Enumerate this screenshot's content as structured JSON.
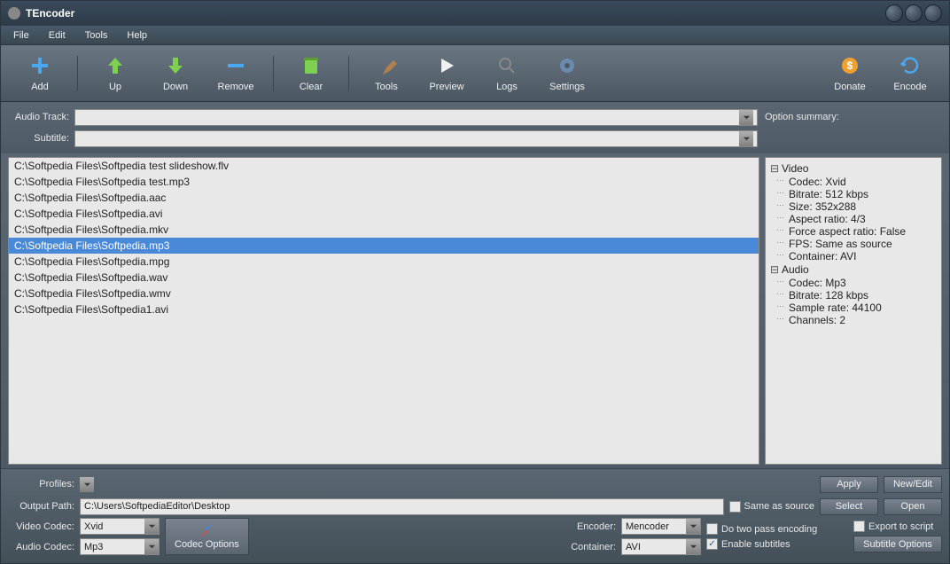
{
  "window": {
    "title": "TEncoder"
  },
  "menu": {
    "items": [
      "File",
      "Edit",
      "Tools",
      "Help"
    ]
  },
  "toolbar": {
    "add": "Add",
    "up": "Up",
    "down": "Down",
    "remove": "Remove",
    "clear": "Clear",
    "tools": "Tools",
    "preview": "Preview",
    "logs": "Logs",
    "settings": "Settings",
    "donate": "Donate",
    "encode": "Encode"
  },
  "tracks": {
    "audio_label": "Audio Track:",
    "audio_value": "",
    "subtitle_label": "Subtitle:",
    "subtitle_value": ""
  },
  "files": [
    "C:\\Softpedia Files\\Softpedia test slideshow.flv",
    "C:\\Softpedia Files\\Softpedia test.mp3",
    "C:\\Softpedia Files\\Softpedia.aac",
    "C:\\Softpedia Files\\Softpedia.avi",
    "C:\\Softpedia Files\\Softpedia.mkv",
    "C:\\Softpedia Files\\Softpedia.mp3",
    "C:\\Softpedia Files\\Softpedia.mpg",
    "C:\\Softpedia Files\\Softpedia.wav",
    "C:\\Softpedia Files\\Softpedia.wmv",
    "C:\\Softpedia Files\\Softpedia1.avi"
  ],
  "selected_index": 5,
  "summary": {
    "header": "Option summary:",
    "video": {
      "label": "Video",
      "codec": "Codec: Xvid",
      "bitrate": "Bitrate: 512 kbps",
      "size": "Size: 352x288",
      "aspect": "Aspect ratio: 4/3",
      "force": "Force aspect ratio: False",
      "fps": "FPS: Same as source",
      "container": "Container: AVI"
    },
    "audio": {
      "label": "Audio",
      "codec": "Codec: Mp3",
      "bitrate": "Bitrate: 128 kbps",
      "sample": "Sample rate: 44100",
      "channels": "Channels: 2"
    }
  },
  "profiles": {
    "label": "Profiles:",
    "value": "",
    "apply": "Apply",
    "newedit": "New/Edit"
  },
  "output": {
    "label": "Output Path:",
    "value": "C:\\Users\\SoftpediaEditor\\Desktop",
    "same_as_source": "Same as source",
    "select": "Select",
    "open": "Open"
  },
  "codec": {
    "video_label": "Video Codec:",
    "video_value": "Xvid",
    "audio_label": "Audio Codec:",
    "audio_value": "Mp3",
    "codec_options": "Codec Options"
  },
  "encoder": {
    "label": "Encoder:",
    "value": "Mencoder",
    "container_label": "Container:",
    "container_value": "AVI",
    "two_pass": "Do two pass encoding",
    "export_script": "Export to script",
    "enable_subs": "Enable subtitles",
    "sub_options": "Subtitle Options"
  },
  "icons": {
    "plus": "+",
    "up": "↑",
    "down": "↓",
    "minus": "−"
  }
}
